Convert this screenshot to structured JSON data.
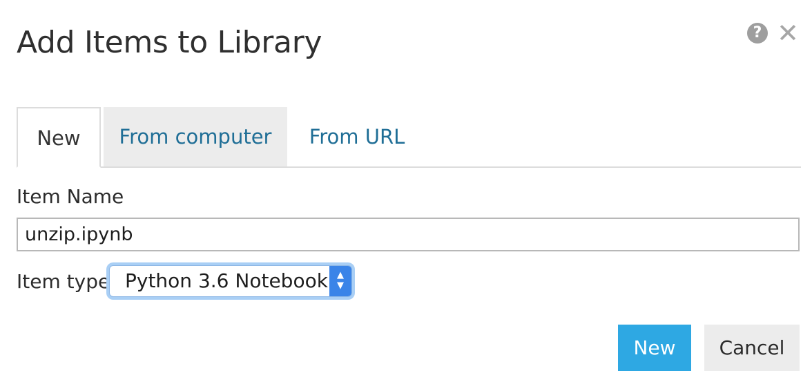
{
  "dialog": {
    "title": "Add Items to Library",
    "help_icon": "question-circle-icon",
    "help_glyph": "?",
    "close_icon": "close-icon",
    "close_glyph": "✕"
  },
  "tabs": [
    {
      "label": "New",
      "active": true
    },
    {
      "label": "From computer",
      "active": false
    },
    {
      "label": "From URL",
      "active": false
    }
  ],
  "form": {
    "item_name_label": "Item Name",
    "item_name_value": "unzip.ipynb",
    "item_type_label": "Item type",
    "item_type_selected": "Python 3.6 Notebook"
  },
  "buttons": {
    "new_label": "New",
    "cancel_label": "Cancel"
  },
  "colors": {
    "accent": "#2ea8e3",
    "tab_link": "#1f6e96",
    "select_focus": "#a9cff5",
    "stepper": "#3a84e8"
  }
}
